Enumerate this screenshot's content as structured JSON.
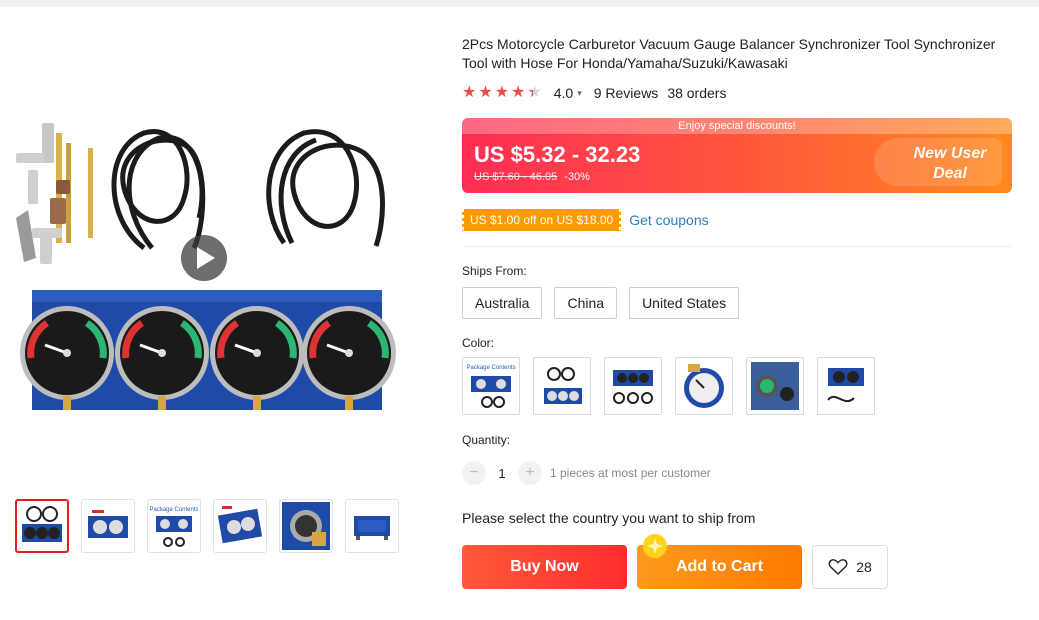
{
  "product": {
    "title": "2Pcs Motorcycle Carburetor Vacuum Gauge Balancer Synchronizer Tool Synchronizer Tool with Hose For Honda/Yamaha/Suzuki/Kawasaki",
    "rating": {
      "stars": 4.0,
      "value_label": "4.0",
      "reviews_label": "9 Reviews",
      "orders_label": "38 orders"
    }
  },
  "price": {
    "banner_text": "Enjoy special discounts!",
    "current": "US $5.32 - 32.23",
    "original": "US $7.60 - 46.05",
    "discount": "-30%",
    "deal_label_line1": "New User",
    "deal_label_line2": "Deal"
  },
  "coupon": {
    "badge": "US $1.00 off on US $18.00",
    "link": "Get coupons"
  },
  "shipping": {
    "label": "Ships From:",
    "options": [
      "Australia",
      "China",
      "United States"
    ]
  },
  "color": {
    "label": "Color:",
    "swatch_thumb_texts": [
      "Package Contents",
      "",
      "",
      "",
      "",
      ""
    ]
  },
  "quantity": {
    "label": "Quantity:",
    "value": "1",
    "decrement": "−",
    "increment": "+",
    "note": "1 pieces at most per customer"
  },
  "ship_message": "Please select the country you want to ship from",
  "actions": {
    "buy_now": "Buy Now",
    "add_to_cart": "Add to Cart",
    "wishlist_count": "28"
  },
  "gallery": {
    "thumb_count": 6,
    "active_index": 0,
    "thumb_text_package": "Package Contents"
  },
  "colors_theme": {
    "accent": "#ff2d55",
    "brand_orange": "#ff7a00",
    "star": "#ee4d4d",
    "link": "#2b7fbf",
    "coupon": "#ff9a00"
  },
  "icons": [
    "play-icon",
    "star-icon",
    "chevron-down-icon",
    "heart-icon",
    "sparkle-icon"
  ]
}
